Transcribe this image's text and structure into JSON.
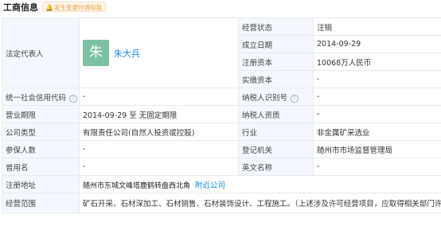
{
  "header": {
    "title": "工商信息",
    "notify_label": "发生变更时通知我"
  },
  "rows": {
    "legal_rep": {
      "label": "法定代表人",
      "avatar_char": "朱",
      "name": "朱大兵"
    },
    "status": {
      "label": "经营状态",
      "value": "注销"
    },
    "founded": {
      "label": "成立日期",
      "value": "2014-09-29"
    },
    "reg_capital": {
      "label": "注册资本",
      "value": "10068万人民币"
    },
    "paid_capital": {
      "label": "实缴资本",
      "value": "-"
    },
    "credit_code": {
      "label": "统一社会信用代码",
      "value": "-"
    },
    "taxpayer_id": {
      "label": "纳税人识别号",
      "value": "-"
    },
    "term": {
      "label": "营业期限",
      "value": "2014-09-29  至  无固定期限"
    },
    "taxpayer_qual": {
      "label": "纳税人资质",
      "value": "-"
    },
    "company_type": {
      "label": "公司类型",
      "value": "有限责任公司(自然人投资或控股)"
    },
    "industry": {
      "label": "行业",
      "value": "非金属矿采选业"
    },
    "insured": {
      "label": "参保人数",
      "value": "-"
    },
    "authority": {
      "label": "登记机关",
      "value": "随州市市场监督管理局"
    },
    "former_name": {
      "label": "曾用名",
      "value": "-"
    },
    "english_name": {
      "label": "英文名称",
      "value": "-"
    },
    "address": {
      "label": "注册地址",
      "value": "随州市东城文峰塔鹿鹤转盘西北角",
      "link": "附近公司"
    },
    "scope": {
      "label": "经营范围",
      "value": "矿石开采、石材深加工、石材销售、石材装饰设计、工程施工。（上述涉及许可经营项目，应取得相关部门许可后方"
    }
  },
  "colors": {
    "label_bg": "#f2f8fd",
    "border": "#e4ebf3",
    "link": "#128bed",
    "avatar": "#7dc2a0",
    "notify": "#e8a23a"
  }
}
